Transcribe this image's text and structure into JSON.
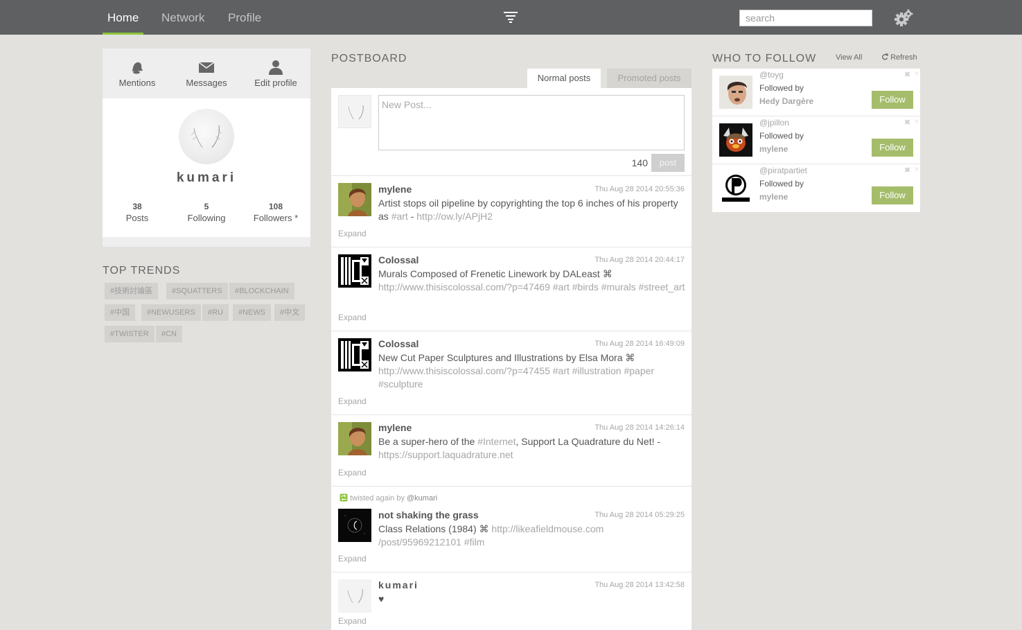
{
  "nav": {
    "tabs": [
      {
        "label": "Home",
        "active": true
      },
      {
        "label": "Network",
        "active": false
      },
      {
        "label": "Profile",
        "active": false
      }
    ],
    "filter_icon": "filter-icon",
    "search_placeholder": "search",
    "settings_icon": "gears-icon",
    "accent": "#8ec43e"
  },
  "profile": {
    "tabs": [
      {
        "label": "Mentions",
        "icon": "bell-icon"
      },
      {
        "label": "Messages",
        "icon": "envelope-icon"
      },
      {
        "label": "Edit profile",
        "icon": "user-icon"
      }
    ],
    "username": "kumari",
    "stats": [
      {
        "num": "38",
        "label": "Posts"
      },
      {
        "num": "5",
        "label": "Following"
      },
      {
        "num": "108",
        "label": "Followers *"
      }
    ]
  },
  "trends": {
    "title": "TOP TRENDS",
    "tags": [
      "#技術討論區",
      "#SQUATTERS",
      "#BLOCKCHAIN",
      "#中国",
      "#NEWUSERS",
      "#RU",
      "#NEWS",
      "#中文",
      "#TWISTER",
      "#CN"
    ]
  },
  "postboard": {
    "title": "POSTBOARD",
    "tab_normal": "Normal posts",
    "tab_promoted": "Promoted posts",
    "composer_placeholder": "New Post...",
    "char_count": "140",
    "post_label": "post",
    "expand_label": "Expand",
    "posts": [
      {
        "author": "mylene",
        "time": "Thu Aug 28 2014 20:55:36",
        "text": "Artist stops oil pipeline by copyrighting the top 6 inches of his property as ",
        "links": [
          "#art",
          " - ",
          "http://ow.ly/APjH2"
        ]
      },
      {
        "author": "Colossal",
        "time": "Thu Aug 28 2014 20:44:17",
        "text": "Murals Composed of Frenetic Linework by DALeast ⌘",
        "links": [
          "http://www.thisiscolossal.com/?p=47469 #art #birds #murals #street_art"
        ]
      },
      {
        "author": "Colossal",
        "time": "Thu Aug 28 2014 16:49:09",
        "text": "New Cut Paper Sculptures and Illustrations by Elsa Mora ⌘",
        "links": [
          "http://www.thisiscolossal.com/?p=47455 #art #illustration #paper #sculpture"
        ]
      },
      {
        "author": "mylene",
        "time": "Thu Aug 28 2014 14:26:14",
        "text_a": "Be a super-hero of the ",
        "link_a": "#Internet",
        "text_b": ", Support La Quadrature du Net! -",
        "link_b": "https://support.laquadrature.net"
      },
      {
        "retwist_prefix": "twisted again by",
        "retwist_user": "@kumari",
        "author": "not shaking the grass",
        "time": "Thu Aug 28 2014 05:29:25",
        "text": "Class Relations (1984) ⌘ ",
        "link_a": "http://likeafieldmouse.com",
        "link_b": "/post/95969212101 #film"
      },
      {
        "author": "kumari",
        "time": "Thu Aug 28 2014 13:42:58",
        "text": "♥"
      }
    ]
  },
  "who_to_follow": {
    "title": "WHO TO FOLLOW",
    "view_all": "View All",
    "refresh": "Refresh",
    "followed_by": "Followed by",
    "follow_label": "Follow",
    "users": [
      {
        "handle": "@toyg",
        "followed_by_name": "Hedy Dargère"
      },
      {
        "handle": "@jpillon",
        "followed_by_name": "mylene"
      },
      {
        "handle": "@piratpartiet",
        "followed_by_name": "mylene"
      }
    ]
  }
}
